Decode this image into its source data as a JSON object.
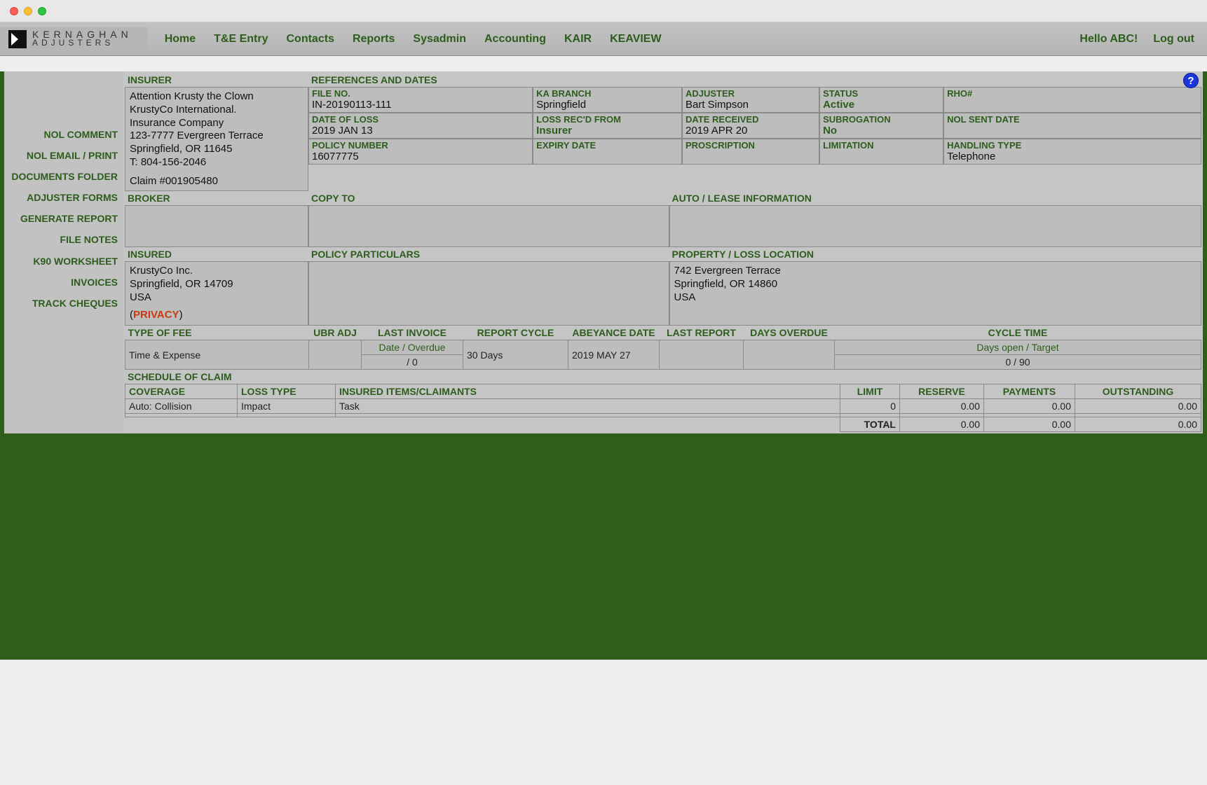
{
  "brand": {
    "line1": "KERNAGHAN",
    "line2": "ADJUSTERS"
  },
  "nav": {
    "home": "Home",
    "te": "T&E Entry",
    "contacts": "Contacts",
    "reports": "Reports",
    "sysadmin": "Sysadmin",
    "accounting": "Accounting",
    "kair": "KAIR",
    "keaview": "KEAVIEW"
  },
  "user": {
    "hello": "Hello ABC!",
    "logout": "Log out"
  },
  "sidebar": {
    "nol_comment": "NOL COMMENT",
    "nol_email": "NOL EMAIL / PRINT",
    "documents": "DOCUMENTS FOLDER",
    "adjuster_forms": "ADJUSTER FORMS",
    "generate_report": "GENERATE REPORT",
    "file_notes": "FILE NOTES",
    "k90": "K90 WORKSHEET",
    "invoices": "INVOICES",
    "track_cheques": "TRACK CHEQUES"
  },
  "headers": {
    "insurer": "INSURER",
    "refs": "REFERENCES AND DATES",
    "broker": "BROKER",
    "copy_to": "COPY TO",
    "auto_lease": "AUTO / LEASE INFORMATION",
    "insured": "INSURED",
    "policy_particulars": "POLICY PARTICULARS",
    "property_loss": "PROPERTY / LOSS LOCATION",
    "schedule": "SCHEDULE OF CLAIM"
  },
  "labels": {
    "file_no": "FILE NO.",
    "ka_branch": "KA BRANCH",
    "adjuster": "ADJUSTER",
    "status": "STATUS",
    "rho": "RHO#",
    "date_of_loss": "DATE OF LOSS",
    "loss_recd": "LOSS REC'D FROM",
    "date_received": "DATE RECEIVED",
    "subrogation": "SUBROGATION",
    "nol_sent": "NOL SENT DATE",
    "policy_number": "POLICY NUMBER",
    "expiry": "EXPIRY DATE",
    "proscription": "PROSCRIPTION",
    "limitation": "LIMITATION",
    "handling": "HANDLING TYPE",
    "type_of_fee": "TYPE OF FEE",
    "ubr_adj": "UBR ADJ",
    "last_invoice": "LAST INVOICE",
    "report_cycle": "REPORT CYCLE",
    "abeyance": "ABEYANCE DATE",
    "last_report": "LAST REPORT",
    "days_overdue": "DAYS OVERDUE",
    "cycle_time": "CYCLE TIME",
    "date_overdue_sub": "Date / Overdue",
    "days_open_target_sub": "Days open / Target",
    "privacy": "PRIVACY",
    "coverage": "COVERAGE",
    "loss_type": "LOSS TYPE",
    "insured_items": "INSURED ITEMS/CLAIMANTS",
    "limit": "LIMIT",
    "reserve": "RESERVE",
    "payments": "PAYMENTS",
    "outstanding": "OUTSTANDING",
    "total": "TOTAL"
  },
  "insurer": {
    "l1": "Attention Krusty the Clown",
    "l2": "KrustyCo International.",
    "l3": "Insurance Company",
    "l4": "123-7777 Evergreen Terrace",
    "l5": "Springfield, OR 11645",
    "l6": "T: 804-156-2046",
    "l7": "Claim #001905480"
  },
  "vals": {
    "file_no": "IN-20190113-111",
    "ka_branch": "Springfield",
    "adjuster": "Bart Simpson",
    "status": "Active",
    "rho": "",
    "date_of_loss": "2019 JAN 13",
    "loss_recd": "Insurer",
    "date_received": "2019 APR 20",
    "subrogation": "No",
    "nol_sent": "",
    "policy_number": "16077775",
    "expiry": "",
    "proscription": "",
    "limitation": "",
    "handling": "Telephone",
    "broker": "",
    "copy_to": "",
    "auto_lease": "",
    "insured_l1": "KrustyCo Inc.",
    "insured_l2": "Springfield, OR 14709",
    "insured_l3": "USA",
    "policy_particulars": "",
    "property_l1": "742 Evergreen Terrace",
    "property_l2": "Springfield, OR 14860",
    "property_l3": "USA",
    "type_of_fee": "Time & Expense",
    "ubr_adj": "",
    "last_invoice_dateoverdue": " / 0",
    "report_cycle": "30 Days",
    "abeyance": "2019 MAY 27",
    "last_report": "",
    "days_overdue": "",
    "cycle_time_sub": "0 / 90"
  },
  "schedule": {
    "rows": [
      {
        "coverage": "Auto: Collision",
        "loss_type": "Impact",
        "items": "Task",
        "limit": "0",
        "reserve": "0.00",
        "payments": "0.00",
        "outstanding": "0.00"
      },
      {
        "coverage": "",
        "loss_type": "",
        "items": "",
        "limit": "",
        "reserve": "",
        "payments": "",
        "outstanding": ""
      }
    ],
    "total": {
      "reserve": "0.00",
      "payments": "0.00",
      "outstanding": "0.00"
    }
  }
}
